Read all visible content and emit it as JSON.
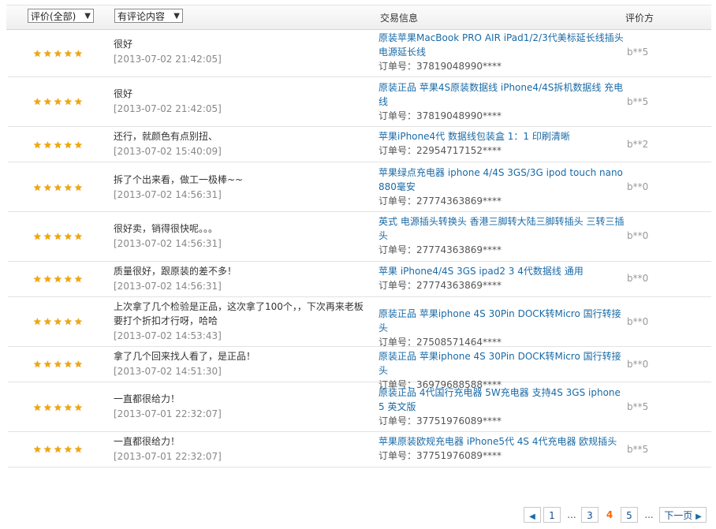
{
  "header": {
    "rating_filter": "评价(全部)",
    "content_filter": "有评论内容",
    "trade_info": "交易信息",
    "rater": "评价方"
  },
  "rows": [
    {
      "stars": 5,
      "comment": "很好",
      "date": "[2013-07-02 21:42:05]",
      "product": "原装苹果MacBook PRO AIR iPad1/2/3代美标延长线插头电源延长线",
      "order": "订单号：37819048990****",
      "rater": "b**5"
    },
    {
      "stars": 5,
      "comment": "很好",
      "date": "[2013-07-02 21:42:05]",
      "product": "原装正品 苹果4S原装数据线 iPhone4/4S拆机数据线 充电线",
      "order": "订单号：37819048990****",
      "rater": "b**5"
    },
    {
      "stars": 5,
      "comment": "还行，就颜色有点别扭、",
      "date": "[2013-07-02 15:40:09]",
      "product": "苹果iPhone4代 数据线包装盒 1：1 印刷清晰",
      "order": "订单号：22954717152****",
      "rater": "b**2"
    },
    {
      "stars": 5,
      "comment": "拆了个出来看，做工一极棒~~",
      "date": "[2013-07-02 14:56:31]",
      "product": "苹果绿点充电器 iphone 4/4S 3GS/3G ipod touch nano 880毫安",
      "order": "订单号：27774363869****",
      "rater": "b**0"
    },
    {
      "stars": 5,
      "comment": "很好卖，销得很快呢。。。",
      "date": "[2013-07-02 14:56:31]",
      "product": "英式 电源插头转换头 香港三脚转大陆三脚转插头 三转三插头",
      "order": "订单号：27774363869****",
      "rater": "b**0"
    },
    {
      "stars": 5,
      "comment": "质量很好，跟原装的差不多！",
      "date": "[2013-07-02 14:56:31]",
      "product": "苹果 iPhone4/4S 3GS ipad2 3 4代数据线 通用",
      "order": "订单号：27774363869****",
      "rater": "b**0"
    },
    {
      "stars": 5,
      "comment": "上次拿了几个检验是正品，这次拿了100个，，下次再来老板要打个折扣才行呀，哈哈",
      "date": "[2013-07-02 14:53:43]",
      "product": "原装正品 苹果iphone 4S 30Pin DOCK转Micro 国行转接头",
      "order": "订单号：27508571464****",
      "rater": "b**0"
    },
    {
      "stars": 5,
      "comment": "拿了几个回来找人看了，是正品！",
      "date": "[2013-07-02 14:51:30]",
      "product": "原装正品 苹果iphone 4S 30Pin DOCK转Micro 国行转接头",
      "order": "订单号：36979688588****",
      "rater": "b**0"
    },
    {
      "stars": 5,
      "comment": "一直都很给力！",
      "date": "[2013-07-01 22:32:07]",
      "product": "原装正品 4代国行充电器 5W充电器 支持4S 3GS iphone 5 英文版",
      "order": "订单号：37751976089****",
      "rater": "b**5"
    },
    {
      "stars": 5,
      "comment": "一直都很给力！",
      "date": "[2013-07-01 22:32:07]",
      "product": "苹果原装欧规充电器 iPhone5代 4S 4代充电器 欧规插头",
      "order": "订单号：37751976089****",
      "rater": "b**5"
    }
  ],
  "pagination": {
    "first": "1",
    "ellipsis": "...",
    "page3": "3",
    "current": "4",
    "page5": "5",
    "next": "下一页"
  }
}
